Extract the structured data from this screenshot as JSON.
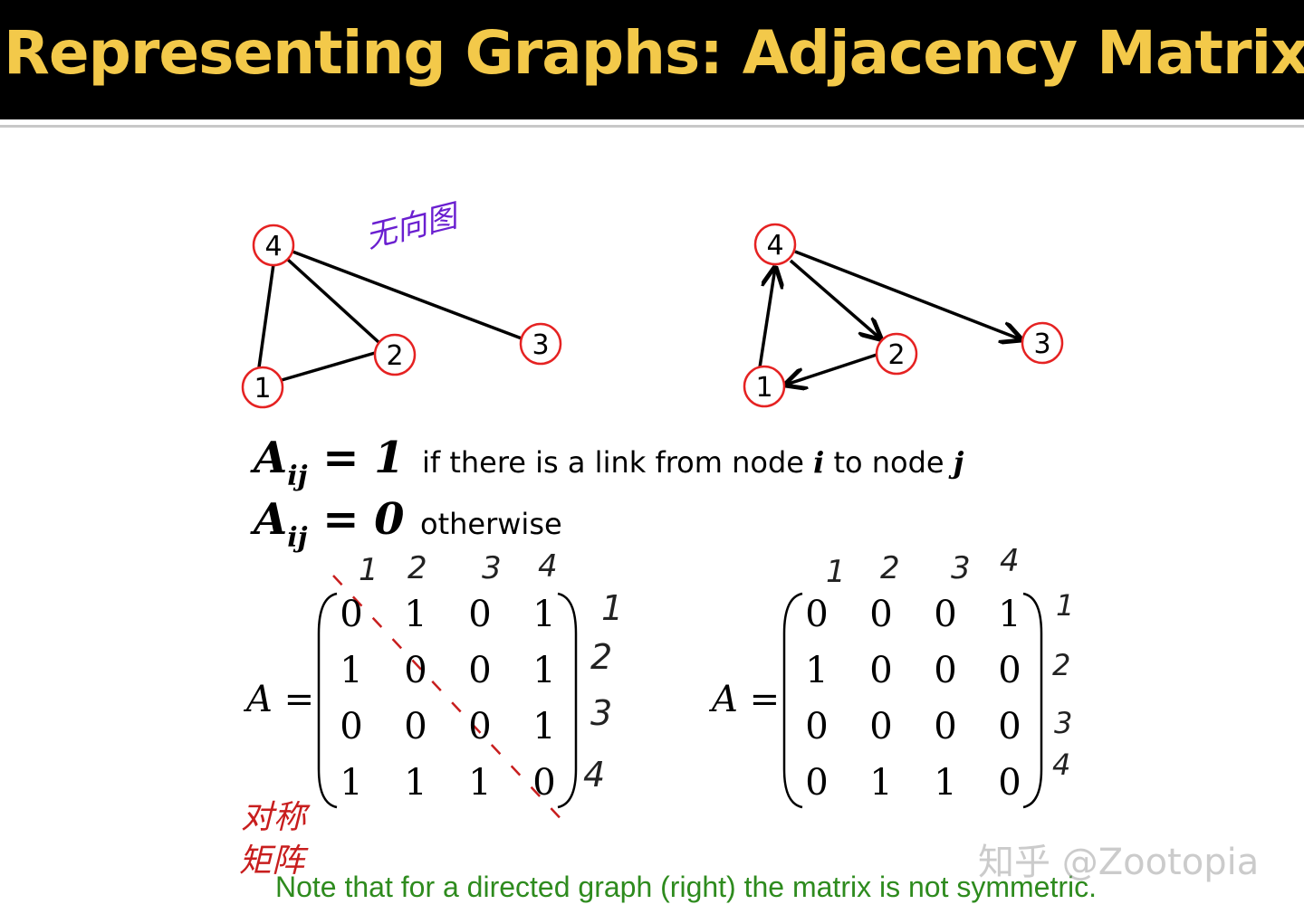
{
  "title": "Representing Graphs: Adjacency Matrix",
  "annotations": {
    "undirected": "无向图",
    "symmetric_line1": "对称",
    "symmetric_line2": "矩阵"
  },
  "graphs": {
    "undirected_nodes": [
      "1",
      "2",
      "3",
      "4"
    ],
    "directed_nodes": [
      "1",
      "2",
      "3",
      "4"
    ]
  },
  "definitions": {
    "row1_lhs": "A",
    "row1_sub": "ij",
    "row1_rhs": " = 1",
    "row1_text_pre": "if there is a link from node ",
    "row1_i": "i",
    "row1_text_mid": " to node ",
    "row1_j": "j",
    "row2_lhs": "A",
    "row2_sub": "ij",
    "row2_rhs": " = 0",
    "row2_text": "otherwise"
  },
  "matrices": {
    "label": "A =",
    "left": [
      [
        "0",
        "1",
        "0",
        "1"
      ],
      [
        "1",
        "0",
        "0",
        "1"
      ],
      [
        "0",
        "0",
        "0",
        "1"
      ],
      [
        "1",
        "1",
        "1",
        "0"
      ]
    ],
    "right": [
      [
        "0",
        "0",
        "0",
        "1"
      ],
      [
        "1",
        "0",
        "0",
        "0"
      ],
      [
        "0",
        "0",
        "0",
        "0"
      ],
      [
        "0",
        "1",
        "1",
        "0"
      ]
    ],
    "left_col_marks": [
      "1",
      "2",
      "3",
      "4"
    ],
    "left_row_marks": [
      "1",
      "2",
      "3",
      "4"
    ],
    "right_col_marks": [
      "1",
      "2",
      "3",
      "4"
    ],
    "right_row_marks": [
      "1",
      "2",
      "3",
      "4"
    ]
  },
  "note": "Note that for a directed graph (right) the matrix is not symmetric.",
  "watermark": "知乎 @Zootopia",
  "colors": {
    "title": "#f3c94a",
    "node_ring": "#e52222",
    "note": "#2e8b1e",
    "annotation_purple": "#6a1fd0",
    "annotation_red": "#c81e1e"
  }
}
